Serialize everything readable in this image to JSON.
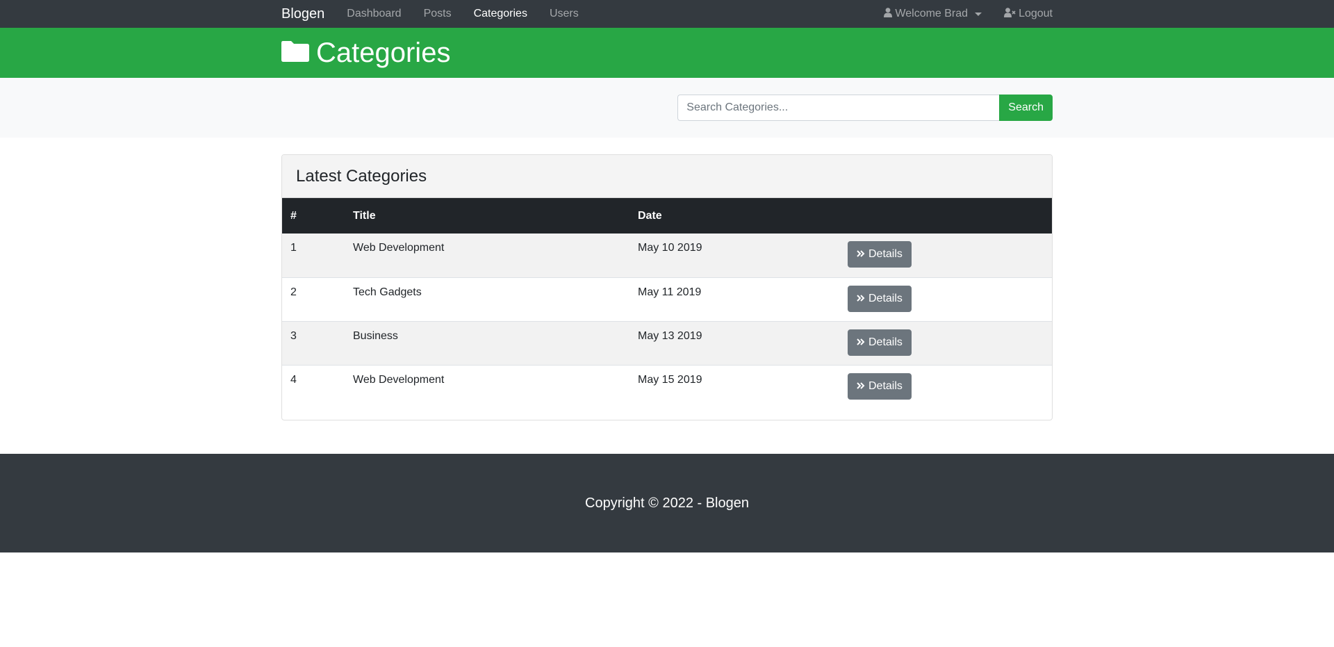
{
  "navbar": {
    "brand": "Blogen",
    "links": [
      {
        "label": "Dashboard",
        "active": false
      },
      {
        "label": "Posts",
        "active": false
      },
      {
        "label": "Categories",
        "active": true
      },
      {
        "label": "Users",
        "active": false
      }
    ],
    "user_menu_label": "Welcome Brad",
    "logout_label": "Logout"
  },
  "header": {
    "title": "Categories",
    "icon": "folder-icon"
  },
  "search": {
    "placeholder": "Search Categories...",
    "button_label": "Search"
  },
  "card": {
    "title": "Latest Categories",
    "columns": [
      "#",
      "Title",
      "Date",
      ""
    ],
    "rows": [
      {
        "num": "1",
        "title": "Web Development",
        "date": "May 10 2019",
        "action": "Details"
      },
      {
        "num": "2",
        "title": "Tech Gadgets",
        "date": "May 11 2019",
        "action": "Details"
      },
      {
        "num": "3",
        "title": "Business",
        "date": "May 13 2019",
        "action": "Details"
      },
      {
        "num": "4",
        "title": "Web Development",
        "date": "May 15 2019",
        "action": "Details"
      }
    ]
  },
  "footer": {
    "copyright": "Copyright © 2022 - Blogen"
  },
  "colors": {
    "navbar": "#343a40",
    "header": "#28a745",
    "search_button": "#28a745",
    "details_button": "#6c757d",
    "table_head": "#212529",
    "footer": "#343a40"
  }
}
